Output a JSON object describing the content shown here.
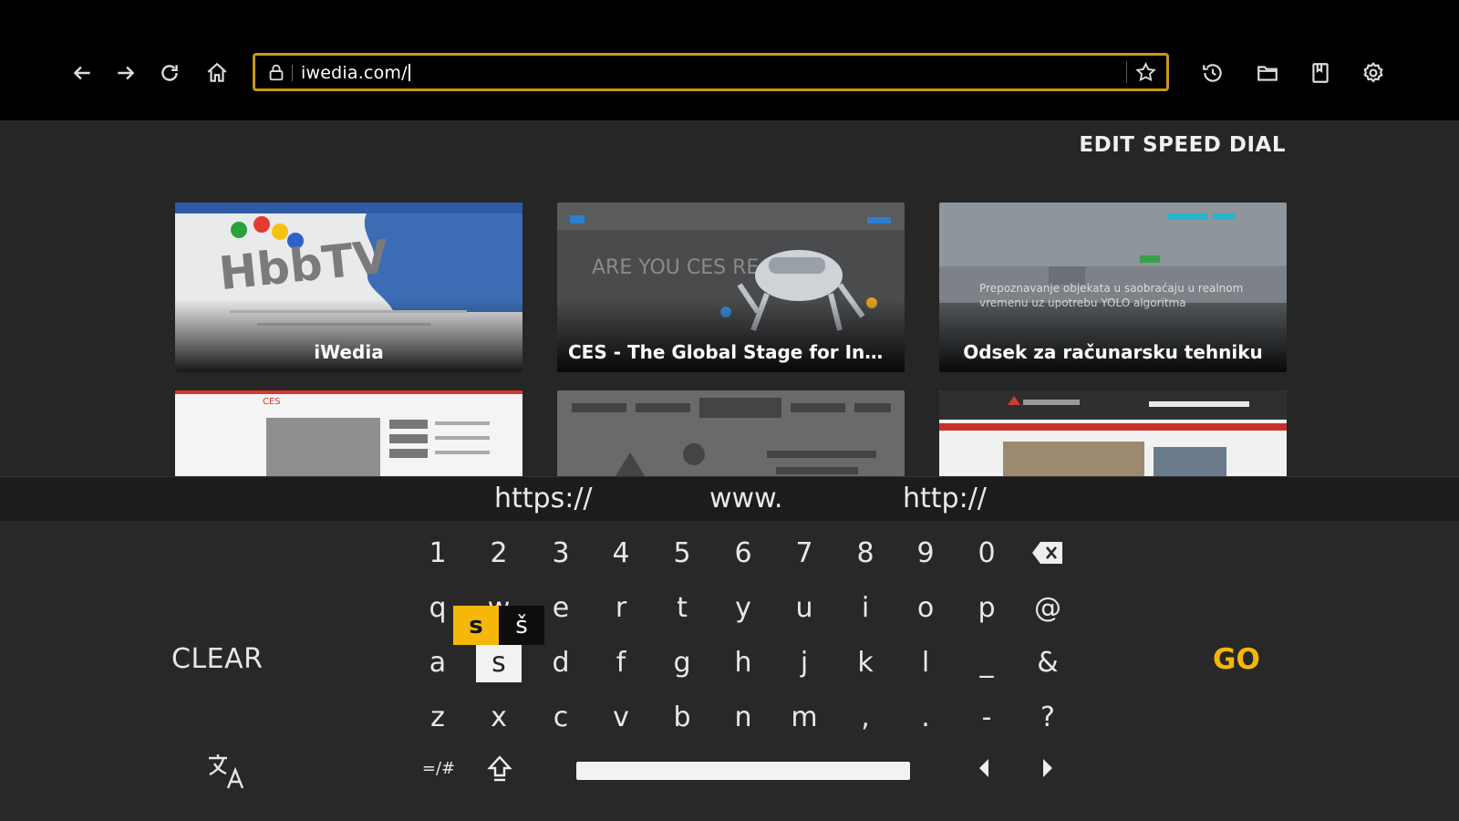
{
  "browser": {
    "url": "iwedia.com/",
    "accent_color": "#c9971a",
    "nav_icons": [
      "back-arrow-icon",
      "forward-arrow-icon",
      "reload-icon",
      "home-icon"
    ],
    "right_icons": [
      "history-icon",
      "folder-icon",
      "bookmarks-icon",
      "settings-gear-icon"
    ]
  },
  "speed_dial": {
    "edit_label": "EDIT SPEED DIAL",
    "tiles": [
      {
        "label": "iWedia"
      },
      {
        "label": "CES - The Global Stage for Inno..."
      },
      {
        "label": "Odsek za računarsku tehniku",
        "thumb_caption": "Prepoznavanje objekata u saobraćaju u realnom vremenu uz upotrebu YOLO algoritma"
      },
      {
        "label": ""
      },
      {
        "label": ""
      },
      {
        "label": ""
      }
    ],
    "tile_text": {
      "hbbtv": "HbbTV",
      "ces_ad": "ARE YOU CES READY?",
      "ces_logo": "CES"
    }
  },
  "keyboard": {
    "suggestions": [
      "https://",
      "www.",
      "http://"
    ],
    "rows": [
      [
        "1",
        "2",
        "3",
        "4",
        "5",
        "6",
        "7",
        "8",
        "9",
        "0"
      ],
      [
        "q",
        "w",
        "e",
        "r",
        "t",
        "y",
        "u",
        "i",
        "o",
        "p",
        "@"
      ],
      [
        "a",
        "s",
        "d",
        "f",
        "g",
        "h",
        "j",
        "k",
        "l",
        "_",
        "&"
      ],
      [
        "z",
        "x",
        "c",
        "v",
        "b",
        "n",
        "m",
        ",",
        ".",
        "-",
        "?"
      ]
    ],
    "focused_key": "s",
    "accent_popup": [
      "s",
      "š"
    ],
    "symbols_label": "=/#",
    "clear_label": "CLEAR",
    "go_label": "GO",
    "go_color": "#f2b807"
  }
}
